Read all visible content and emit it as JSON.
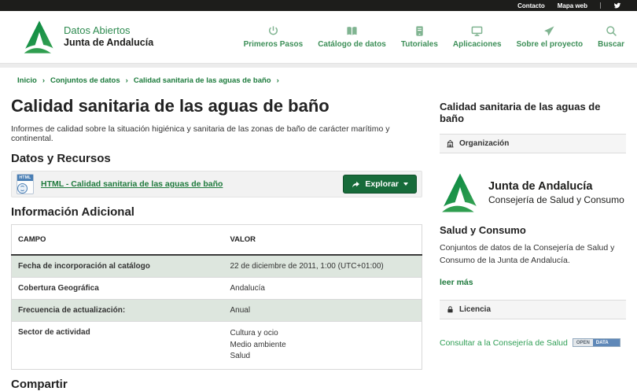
{
  "topbar": {
    "contacto": "Contacto",
    "mapa_web": "Mapa web",
    "social_icon": "twitter-icon"
  },
  "header": {
    "brand_line1": "Datos Abiertos",
    "brand_line2": "Junta de Andalucía",
    "logo_icon": "junta-andalucia-a-logo",
    "nav": [
      {
        "label": "Primeros Pasos",
        "icon": "power-icon"
      },
      {
        "label": "Catálogo de datos",
        "icon": "book-icon"
      },
      {
        "label": "Tutoriales",
        "icon": "reader-icon"
      },
      {
        "label": "Aplicaciones",
        "icon": "monitor-icon"
      },
      {
        "label": "Sobre el proyecto",
        "icon": "send-icon"
      },
      {
        "label": "Buscar",
        "icon": "search-icon"
      }
    ]
  },
  "breadcrumb": {
    "separator": "›",
    "items": [
      "Inicio",
      "Conjuntos de datos",
      "Calidad sanitaria de las aguas de baño"
    ]
  },
  "main": {
    "title": "Calidad sanitaria de las aguas de baño",
    "description": "Informes de calidad sobre la situación higiénica y sanitaria de las zonas de baño de carácter marítimo y continental.",
    "resources_heading": "Datos y Recursos",
    "resource": {
      "icon": "html-file-icon",
      "link_label": "HTML - Calidad sanitaria de las aguas de baño",
      "button_label": "Explorar"
    },
    "additional_heading": "Información Adicional",
    "table": {
      "headers": [
        "CAMPO",
        "VALOR"
      ],
      "rows": [
        {
          "campo": "Fecha de incorporación al catálogo",
          "valor": "22 de diciembre de 2011, 1:00 (UTC+01:00)"
        },
        {
          "campo": "Cobertura Geográfica",
          "valor": "Andalucía"
        },
        {
          "campo": "Frecuencia de actualización:",
          "valor": "Anual"
        },
        {
          "campo": "Sector de actividad",
          "valor": [
            "Cultura y ocio",
            "Medio ambiente",
            "Salud"
          ]
        }
      ]
    },
    "clipped_heading": "Compartir"
  },
  "sidebar": {
    "title": "Calidad sanitaria de las aguas de baño",
    "organizacion_label": "Organización",
    "organizacion_icon": "building-icon",
    "org_logo_icon": "junta-andalucia-a-logo",
    "org_logo_line1": "Junta de Andalucía",
    "org_logo_line2": "Consejería de Salud y Consumo",
    "org_name": "Salud y Consumo",
    "org_description": "Conjuntos de datos de la Consejería de Salud y Consumo de la Junta de Andalucía.",
    "leer_mas": "leer más",
    "licencia_label": "Licencia",
    "licencia_icon": "lock-icon",
    "license_link": "Consultar a la Consejería de Salud",
    "open_data_badge": {
      "open": "OPEN",
      "data": "DATA"
    }
  },
  "colors": {
    "brand_green_dark": "#00843d",
    "brand_green_light": "#3da556",
    "nav_green": "#3d8f58",
    "link_green": "#1f7a3d",
    "button_green": "#176b3a",
    "table_stripe": "#dde6de",
    "topbar_black": "#1d1d1b",
    "badge_blue": "#5f88b8"
  }
}
